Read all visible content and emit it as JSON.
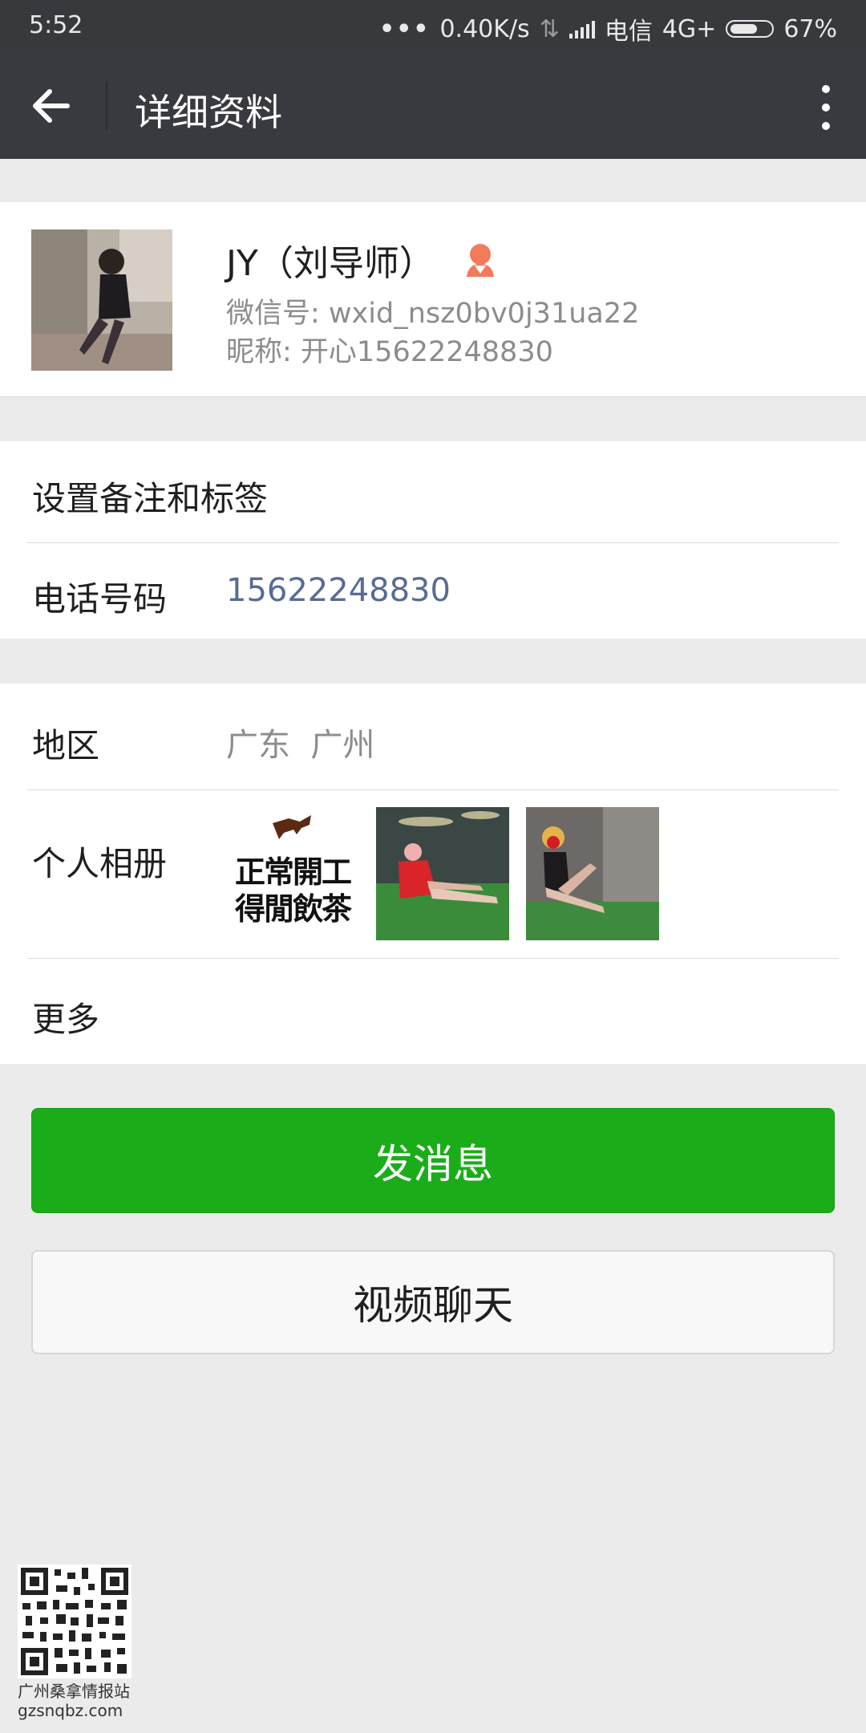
{
  "status_bar": {
    "time": "5:52",
    "dots": "•••",
    "speed": "0.40K/s",
    "carrier": "电信",
    "network": "4G+",
    "battery": "67%"
  },
  "nav": {
    "title": "详细资料",
    "back_icon": "arrow-left-icon",
    "more_icon": "more-vertical-icon"
  },
  "profile": {
    "name": "JY（刘导师）",
    "gender_icon": "female-icon",
    "wechat_id": "微信号: wxid_nsz0bv0j31ua22",
    "nickname": "昵称: 开心15622248830"
  },
  "rows": {
    "remark_label": "设置备注和标签",
    "phone_label": "电话号码",
    "phone_value": "15622248830",
    "region_label": "地区",
    "region_value": "广东  广州",
    "album_label": "个人相册",
    "album_photo1_text": "正常開工 得閒飲茶",
    "more_label": "更多"
  },
  "buttons": {
    "send_message": "发消息",
    "video_chat": "视频聊天"
  },
  "watermark": {
    "site_name": "广州桑拿情报站",
    "url": "gzsnqbz.com"
  },
  "colors": {
    "primary_green": "#1aad19",
    "navbar": "#393a3f",
    "link_blue": "#576b95"
  }
}
